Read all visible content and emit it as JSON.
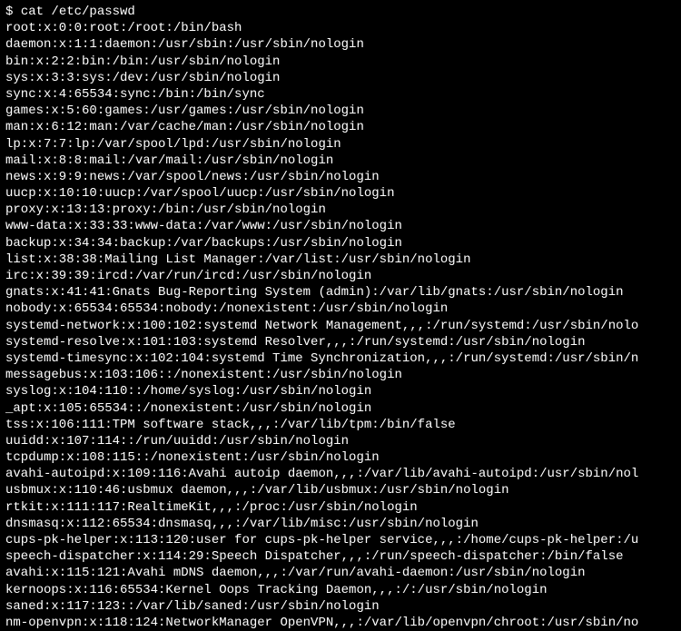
{
  "prompt": "$ ",
  "command": "cat /etc/passwd",
  "lines": [
    "root:x:0:0:root:/root:/bin/bash",
    "daemon:x:1:1:daemon:/usr/sbin:/usr/sbin/nologin",
    "bin:x:2:2:bin:/bin:/usr/sbin/nologin",
    "sys:x:3:3:sys:/dev:/usr/sbin/nologin",
    "sync:x:4:65534:sync:/bin:/bin/sync",
    "games:x:5:60:games:/usr/games:/usr/sbin/nologin",
    "man:x:6:12:man:/var/cache/man:/usr/sbin/nologin",
    "lp:x:7:7:lp:/var/spool/lpd:/usr/sbin/nologin",
    "mail:x:8:8:mail:/var/mail:/usr/sbin/nologin",
    "news:x:9:9:news:/var/spool/news:/usr/sbin/nologin",
    "uucp:x:10:10:uucp:/var/spool/uucp:/usr/sbin/nologin",
    "proxy:x:13:13:proxy:/bin:/usr/sbin/nologin",
    "www-data:x:33:33:www-data:/var/www:/usr/sbin/nologin",
    "backup:x:34:34:backup:/var/backups:/usr/sbin/nologin",
    "list:x:38:38:Mailing List Manager:/var/list:/usr/sbin/nologin",
    "irc:x:39:39:ircd:/var/run/ircd:/usr/sbin/nologin",
    "gnats:x:41:41:Gnats Bug-Reporting System (admin):/var/lib/gnats:/usr/sbin/nologin",
    "nobody:x:65534:65534:nobody:/nonexistent:/usr/sbin/nologin",
    "systemd-network:x:100:102:systemd Network Management,,,:/run/systemd:/usr/sbin/nolo",
    "systemd-resolve:x:101:103:systemd Resolver,,,:/run/systemd:/usr/sbin/nologin",
    "systemd-timesync:x:102:104:systemd Time Synchronization,,,:/run/systemd:/usr/sbin/n",
    "messagebus:x:103:106::/nonexistent:/usr/sbin/nologin",
    "syslog:x:104:110::/home/syslog:/usr/sbin/nologin",
    "_apt:x:105:65534::/nonexistent:/usr/sbin/nologin",
    "tss:x:106:111:TPM software stack,,,:/var/lib/tpm:/bin/false",
    "uuidd:x:107:114::/run/uuidd:/usr/sbin/nologin",
    "tcpdump:x:108:115::/nonexistent:/usr/sbin/nologin",
    "avahi-autoipd:x:109:116:Avahi autoip daemon,,,:/var/lib/avahi-autoipd:/usr/sbin/nol",
    "usbmux:x:110:46:usbmux daemon,,,:/var/lib/usbmux:/usr/sbin/nologin",
    "rtkit:x:111:117:RealtimeKit,,,:/proc:/usr/sbin/nologin",
    "dnsmasq:x:112:65534:dnsmasq,,,:/var/lib/misc:/usr/sbin/nologin",
    "cups-pk-helper:x:113:120:user for cups-pk-helper service,,,:/home/cups-pk-helper:/u",
    "speech-dispatcher:x:114:29:Speech Dispatcher,,,:/run/speech-dispatcher:/bin/false",
    "avahi:x:115:121:Avahi mDNS daemon,,,:/var/run/avahi-daemon:/usr/sbin/nologin",
    "kernoops:x:116:65534:Kernel Oops Tracking Daemon,,,:/:/usr/sbin/nologin",
    "saned:x:117:123::/var/lib/saned:/usr/sbin/nologin",
    "nm-openvpn:x:118:124:NetworkManager OpenVPN,,,:/var/lib/openvpn/chroot:/usr/sbin/no"
  ]
}
